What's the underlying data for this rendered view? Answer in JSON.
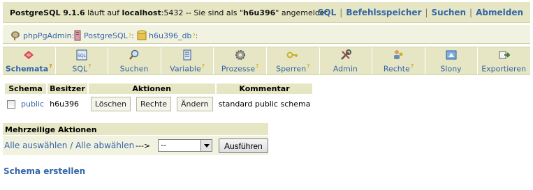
{
  "topbar": {
    "server_prefix": "PostgreSQL 9.1.6",
    "server_mid": " läuft auf ",
    "server_host": "localhost",
    "server_port_text": ":5432 -- Sie sind als \"",
    "server_user": "h6u396",
    "server_suffix": "\" angemeldet",
    "links": [
      "SQL",
      "Befehlsspeicher",
      "Suchen",
      "Abmelden"
    ]
  },
  "breadcrumb": {
    "items": [
      "phpPgAdmin",
      "PostgreSQL",
      "h6u396_db"
    ]
  },
  "tabs": [
    {
      "label": "Schemata",
      "icon": "schemata-icon",
      "help": "?"
    },
    {
      "label": "SQL",
      "icon": "sql-icon",
      "help": "?"
    },
    {
      "label": "Suchen",
      "icon": "search-icon",
      "help": ""
    },
    {
      "label": "Variable",
      "icon": "variable-icon",
      "help": "?"
    },
    {
      "label": "Prozesse",
      "icon": "process-gear-icon",
      "help": "?"
    },
    {
      "label": "Sperren",
      "icon": "key-icon",
      "help": "?"
    },
    {
      "label": "Admin",
      "icon": "admin-tools-icon",
      "help": ""
    },
    {
      "label": "Rechte",
      "icon": "users-icon",
      "help": "?"
    },
    {
      "label": "Slony",
      "icon": "slony-icon",
      "help": ""
    },
    {
      "label": "Exportieren",
      "icon": "export-icon",
      "help": ""
    }
  ],
  "table": {
    "headers": [
      "Schema",
      "Besitzer",
      "Aktionen",
      "Kommentar"
    ],
    "rows": [
      {
        "schema": "public",
        "owner": "h6u396",
        "actions": [
          "Löschen",
          "Rechte",
          "Ändern"
        ],
        "comment": "standard public schema"
      }
    ]
  },
  "multi": {
    "title": "Mehrzeilige Aktionen",
    "select_all": "Alle auswählen",
    "divider": " / ",
    "deselect_all": "Alle abwählen",
    "arrow": "--->",
    "select_value": "--",
    "run_label": "Ausführen"
  },
  "create_link": "Schema erstellen",
  "colors": {
    "accent": "#3566a6",
    "bar": "#e6e6c5",
    "help": "#c9a000"
  }
}
